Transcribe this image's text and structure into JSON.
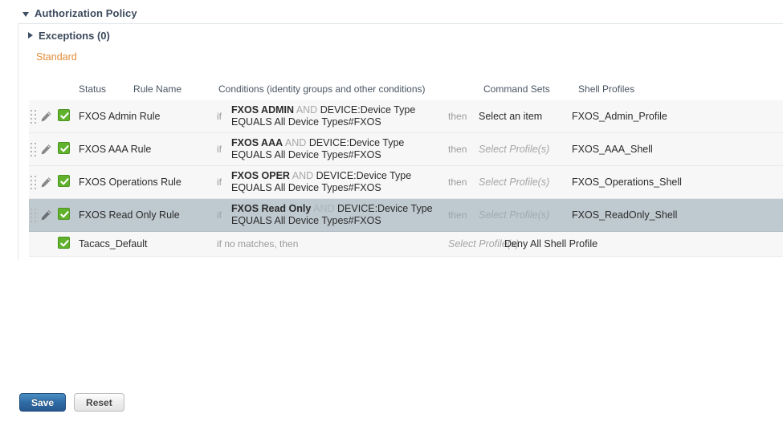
{
  "panel": {
    "title": "Authorization Policy",
    "collapse_icon": "triangle-down-icon"
  },
  "exceptions": {
    "label": "Exceptions (0)",
    "expand_icon": "triangle-right-icon"
  },
  "standard": {
    "label": "Standard"
  },
  "table": {
    "headers": {
      "status": "Status",
      "rule_name": "Rule Name",
      "conditions": "Conditions (identity groups and other conditions)",
      "command_sets": "Command Sets",
      "shell_profiles": "Shell Profiles"
    },
    "rows": [
      {
        "handle_icon": "drag-handle-icon",
        "edit_icon": "pencil-icon",
        "status_icon": "green-check-icon",
        "name": "FXOS Admin Rule",
        "if_label": "if",
        "cond_bold": "FXOS ADMIN",
        "cond_and": "AND",
        "cond_rest": "DEVICE:Device Type",
        "cond_line2": "EQUALS All Device Types#FXOS",
        "then_label": "then",
        "command_sets": "Select an item",
        "command_sets_placeholder": false,
        "shell_profile": "FXOS_Admin_Profile",
        "selected": false
      },
      {
        "handle_icon": "drag-handle-icon",
        "edit_icon": "pencil-icon",
        "status_icon": "green-check-icon",
        "name": "FXOS AAA Rule",
        "if_label": "if",
        "cond_bold": "FXOS AAA",
        "cond_and": "AND",
        "cond_rest": "DEVICE:Device Type",
        "cond_line2": "EQUALS All Device Types#FXOS",
        "then_label": "then",
        "command_sets": "Select Profile(s)",
        "command_sets_placeholder": true,
        "shell_profile": "FXOS_AAA_Shell",
        "selected": false
      },
      {
        "handle_icon": "drag-handle-icon",
        "edit_icon": "pencil-icon",
        "status_icon": "green-check-icon",
        "name": "FXOS Operations Rule",
        "if_label": "if",
        "cond_bold": "FXOS OPER",
        "cond_and": "AND",
        "cond_rest": "DEVICE:Device Type",
        "cond_line2": "EQUALS All Device Types#FXOS",
        "then_label": "then",
        "command_sets": "Select Profile(s)",
        "command_sets_placeholder": true,
        "shell_profile": "FXOS_Operations_Shell",
        "selected": false
      },
      {
        "handle_icon": "drag-handle-icon",
        "edit_icon": "pencil-icon",
        "status_icon": "green-check-icon",
        "name": "FXOS Read Only Rule",
        "if_label": "if",
        "cond_bold": "FXOS Read Only",
        "cond_and": "AND",
        "cond_rest": "DEVICE:Device Type",
        "cond_line2": "EQUALS All Device Types#FXOS",
        "then_label": "then",
        "command_sets": "Select Profile(s)",
        "command_sets_placeholder": true,
        "shell_profile": "FXOS_ReadOnly_Shell",
        "selected": true
      }
    ],
    "default_row": {
      "status_icon": "green-check-icon",
      "name": "Tacacs_Default",
      "if_label": "if no matches, then",
      "command_sets": "Select Profile(s)",
      "shell_profile": "Deny All Shell Profile"
    }
  },
  "buttons": {
    "save": "Save",
    "reset": "Reset"
  },
  "colors": {
    "accent_orange": "#e08c37",
    "status_green": "#60b22c",
    "selected_row": "#bfc9d0",
    "title_navy": "#3c4a5c",
    "primary_button": "#2f6ca6"
  }
}
